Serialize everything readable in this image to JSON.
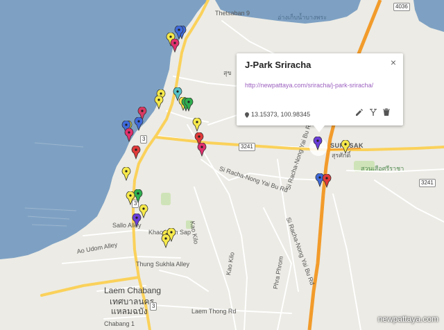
{
  "map": {
    "colors": {
      "water": "#7ea1c3",
      "land": "#ecebe5",
      "highway": "#f29b2b",
      "main_road": "#fad15a",
      "road": "#ffffff"
    },
    "labels": {
      "thetsaban": "Thetsaban 9",
      "thai_top": "อ่างเก็บน้ำบางพระ",
      "sukhumvit_thai": "สุข",
      "surasak": "SURASAK",
      "surasak_thai": "สุรศักดิ์",
      "park_thai": "สวนเสือศรีราชา",
      "road_sriracha_nong_yai_bu": "Si Racha-Nong Yai Bu Rd",
      "road_sriracha_nong_yai_bu_2": "Si Racha-Nong Yai Bu Rd",
      "road_sriracha_side": "Si Racha-Nong Yai Bu Rd",
      "saloo_alley": "Sallo Alley",
      "khao_nam_sap": "Khao Nam Sap",
      "ao_udom": "Ao Udom Alley",
      "thung_sukhla": "Thung Sukhla Alley",
      "laem_chabang": "Laem Chabang",
      "laem_chabang_thai": "เทศบาลนคร",
      "laem_chabang_thai2": "แหลมฉบัง",
      "kao_kilo": "Kao Kilo",
      "kao_kilo_2": "Kao Kilo",
      "laem_thong": "Laem Thong Rd",
      "chabang": "Chabang 1",
      "phra_phrom": "Phra Phrom"
    },
    "shields": {
      "r3_a": "3",
      "r3_b": "3",
      "r3_c": "3",
      "r3241_a": "3241",
      "r3241_b": "3241",
      "r4036": "4036"
    },
    "pins": [
      {
        "color": "#f6e94b"
      },
      {
        "color": "#3f6ad9"
      },
      {
        "color": "#e0316d"
      },
      {
        "color": "#3f6ad9"
      },
      {
        "color": "#f6e94b"
      },
      {
        "color": "#f6e94b"
      },
      {
        "color": "#56c2c8"
      },
      {
        "color": "#f6e94b"
      },
      {
        "color": "#2fae4f"
      },
      {
        "color": "#2fae4f"
      },
      {
        "color": "#d73a63"
      },
      {
        "color": "#3f6ad9"
      },
      {
        "color": "#f6e94b"
      },
      {
        "color": "#3f6ad9"
      },
      {
        "color": "#e0316d"
      },
      {
        "color": "#f6e94b"
      },
      {
        "color": "#e03a3a"
      },
      {
        "color": "#e03a3a"
      },
      {
        "color": "#e0316d"
      },
      {
        "color": "#f6e94b"
      },
      {
        "color": "#2fae4f"
      },
      {
        "color": "#f6e94b"
      },
      {
        "color": "#f6e94b"
      },
      {
        "color": "#6b3fd9"
      },
      {
        "color": "#f6e94b"
      },
      {
        "color": "#f6e94b"
      },
      {
        "color": "#f6e94b"
      },
      {
        "color": "#6b3fd9"
      },
      {
        "color": "#f6e94b"
      },
      {
        "color": "#3f6ad9"
      },
      {
        "color": "#e03a3a"
      }
    ],
    "selected_pin_color": "#6b3fd9"
  },
  "popup": {
    "title": "J-Park Sriracha",
    "link": "http://newpattaya.com/sriracha/j-park-sriracha/",
    "coords": "13.15373, 100.98345",
    "close_label": "×"
  },
  "watermark": "newpattaya.com"
}
